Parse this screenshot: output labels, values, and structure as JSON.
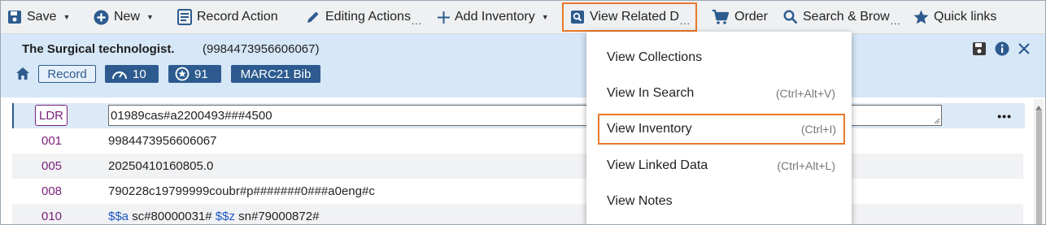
{
  "toolbar": {
    "save": "Save",
    "new": "New",
    "record_actions": "Record Action",
    "editing_actions": "Editing Actions",
    "add_inventory": "Add Inventory",
    "view_related": "View Related D",
    "order": "Order",
    "search_browse": "Search & Brow",
    "quick_links": "Quick links",
    "overflow_dots": "..."
  },
  "record": {
    "title": "The Surgical technologist.",
    "id": "(9984473956606067)",
    "badge_record": "Record",
    "score1": "10",
    "score2": "91",
    "format": "MARC21 Bib"
  },
  "editor": {
    "ldr": {
      "tag": "LDR",
      "value": "01989cas#a2200493###4500"
    },
    "rows": [
      {
        "tag": "001",
        "value": "9984473956606067"
      },
      {
        "tag": "005",
        "value": "20250410160805.0"
      },
      {
        "tag": "008",
        "value": "790228c19799999coubr#p#######0###a0eng#c"
      },
      {
        "tag": "010",
        "sf1": "$$a",
        "v1": " sc#80000031# ",
        "sf2": "$$z",
        "v2": " sn#79000872#"
      }
    ],
    "row_menu": "•••"
  },
  "menu": {
    "items": [
      {
        "label": "View Collections",
        "shortcut": ""
      },
      {
        "label": "View In Search",
        "shortcut": "(Ctrl+Alt+V)"
      },
      {
        "label": "View Inventory",
        "shortcut": "(Ctrl+I)"
      },
      {
        "label": "View Linked Data",
        "shortcut": "(Ctrl+Alt+L)"
      },
      {
        "label": "View Notes",
        "shortcut": ""
      }
    ]
  },
  "colors": {
    "accent_orange": "#e8792b",
    "brand_blue": "#2d5b8f",
    "header_bg": "#d6e7f7",
    "tag_purple": "#7a1f7a",
    "subfield_blue": "#1a56c4"
  },
  "icons": [
    "save-icon",
    "plus-circle-icon",
    "record-doc-icon",
    "pencil-icon",
    "plus-icon",
    "search-doc-icon",
    "cart-icon",
    "magnifier-icon",
    "star-icon",
    "home-icon",
    "gauge-icon",
    "award-icon",
    "floppy-icon",
    "info-icon",
    "close-icon"
  ]
}
